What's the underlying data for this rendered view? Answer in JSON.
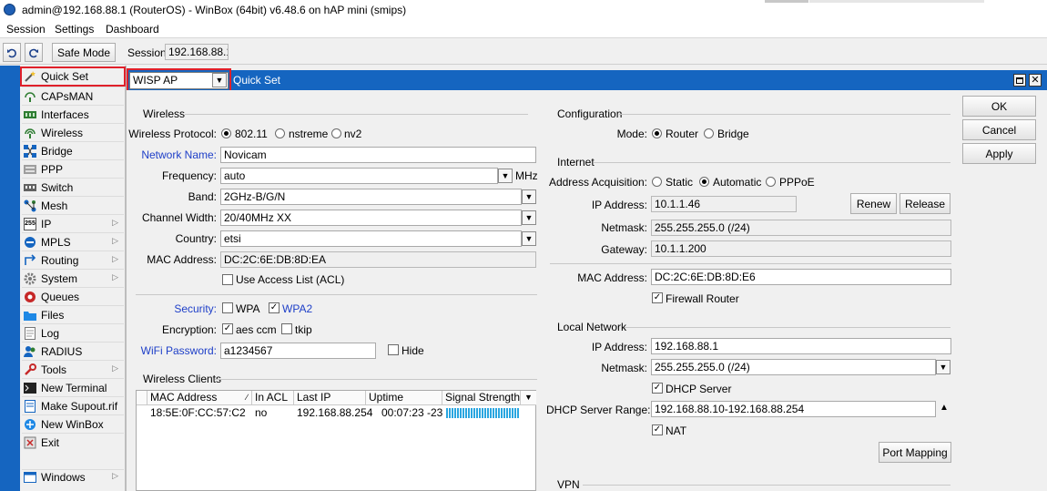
{
  "window": {
    "title": "admin@192.168.88.1 (RouterOS) - WinBox (64bit) v6.48.6 on hAP mini (smips)"
  },
  "menu": [
    "Session",
    "Settings",
    "Dashboard"
  ],
  "toolbar": {
    "undo_icon": "undo-icon",
    "redo_icon": "redo-icon",
    "safe_mode": "Safe Mode",
    "session_label": "Session:",
    "session_value": "192.168.88.1"
  },
  "sidebar": {
    "accent": "#1565c0",
    "items": [
      {
        "label": "Quick Set",
        "icon": "wand-icon",
        "arrow": false
      },
      {
        "label": "CAPsMAN",
        "icon": "capsman-icon",
        "arrow": false
      },
      {
        "label": "Interfaces",
        "icon": "interfaces-icon",
        "arrow": false
      },
      {
        "label": "Wireless",
        "icon": "wireless-icon",
        "arrow": false
      },
      {
        "label": "Bridge",
        "icon": "bridge-icon",
        "arrow": false
      },
      {
        "label": "PPP",
        "icon": "ppp-icon",
        "arrow": false
      },
      {
        "label": "Switch",
        "icon": "switch-icon",
        "arrow": false
      },
      {
        "label": "Mesh",
        "icon": "mesh-icon",
        "arrow": false
      },
      {
        "label": "IP",
        "icon": "ip-icon",
        "arrow": true
      },
      {
        "label": "MPLS",
        "icon": "mpls-icon",
        "arrow": true
      },
      {
        "label": "Routing",
        "icon": "routing-icon",
        "arrow": true
      },
      {
        "label": "System",
        "icon": "system-icon",
        "arrow": true
      },
      {
        "label": "Queues",
        "icon": "queues-icon",
        "arrow": false
      },
      {
        "label": "Files",
        "icon": "files-icon",
        "arrow": false
      },
      {
        "label": "Log",
        "icon": "log-icon",
        "arrow": false
      },
      {
        "label": "RADIUS",
        "icon": "radius-icon",
        "arrow": false
      },
      {
        "label": "Tools",
        "icon": "tools-icon",
        "arrow": true
      },
      {
        "label": "New Terminal",
        "icon": "terminal-icon",
        "arrow": false
      },
      {
        "label": "Make Supout.rif",
        "icon": "supout-icon",
        "arrow": false
      },
      {
        "label": "New WinBox",
        "icon": "winbox-icon",
        "arrow": false
      },
      {
        "label": "Exit",
        "icon": "exit-icon",
        "arrow": false
      }
    ],
    "windows": "Windows"
  },
  "quickset": {
    "mode": "WISP AP",
    "caption": "Quick Set",
    "buttons": {
      "ok": "OK",
      "cancel": "Cancel",
      "apply": "Apply"
    },
    "wireless": {
      "section": "Wireless",
      "protocol_label": "Wireless Protocol:",
      "protocols": [
        "802.11",
        "nstreme",
        "nv2"
      ],
      "protocol_selected": "802.11",
      "network_name_label": "Network Name:",
      "network_name": "Novicam",
      "frequency_label": "Frequency:",
      "frequency": "auto",
      "frequency_unit": "MHz",
      "band_label": "Band:",
      "band": "2GHz-B/G/N",
      "channel_width_label": "Channel Width:",
      "channel_width": "20/40MHz XX",
      "country_label": "Country:",
      "country": "etsi",
      "mac_label": "MAC Address:",
      "mac": "DC:2C:6E:DB:8D:EA",
      "use_acl": "Use Access List (ACL)",
      "security_label": "Security:",
      "wpa": "WPA",
      "wpa2": "WPA2",
      "encryption_label": "Encryption:",
      "aes": "aes ccm",
      "tkip": "tkip",
      "password_label": "WiFi Password:",
      "password": "a1234567",
      "hide": "Hide"
    },
    "clients": {
      "section": "Wireless Clients",
      "columns": [
        "MAC Address",
        "In ACL",
        "Last IP",
        "Uptime",
        "Signal Strength"
      ],
      "rows": [
        {
          "mac": "18:5E:0F:CC:57:C2",
          "in_acl": "no",
          "last_ip": "192.168.88.254",
          "uptime": "00:07:23",
          "signal": "-23"
        }
      ]
    },
    "configuration": {
      "section": "Configuration",
      "mode_label": "Mode:",
      "modes": [
        "Router",
        "Bridge"
      ],
      "mode_selected": "Router"
    },
    "internet": {
      "section": "Internet",
      "acq_label": "Address Acquisition:",
      "acq_options": [
        "Static",
        "Automatic",
        "PPPoE"
      ],
      "acq_selected": "Automatic",
      "ip_label": "IP Address:",
      "ip": "10.1.1.46",
      "renew": "Renew",
      "release": "Release",
      "netmask_label": "Netmask:",
      "netmask": "255.255.255.0 (/24)",
      "gateway_label": "Gateway:",
      "gateway": "10.1.1.200",
      "mac_label": "MAC Address:",
      "mac": "DC:2C:6E:DB:8D:E6",
      "firewall": "Firewall Router"
    },
    "local": {
      "section": "Local Network",
      "ip_label": "IP Address:",
      "ip": "192.168.88.1",
      "netmask_label": "Netmask:",
      "netmask": "255.255.255.0 (/24)",
      "dhcp_server": "DHCP Server",
      "range_label": "DHCP Server Range:",
      "range": "192.168.88.10-192.168.88.254",
      "nat": "NAT",
      "port_mapping": "Port Mapping"
    },
    "vpn": {
      "section": "VPN"
    }
  }
}
